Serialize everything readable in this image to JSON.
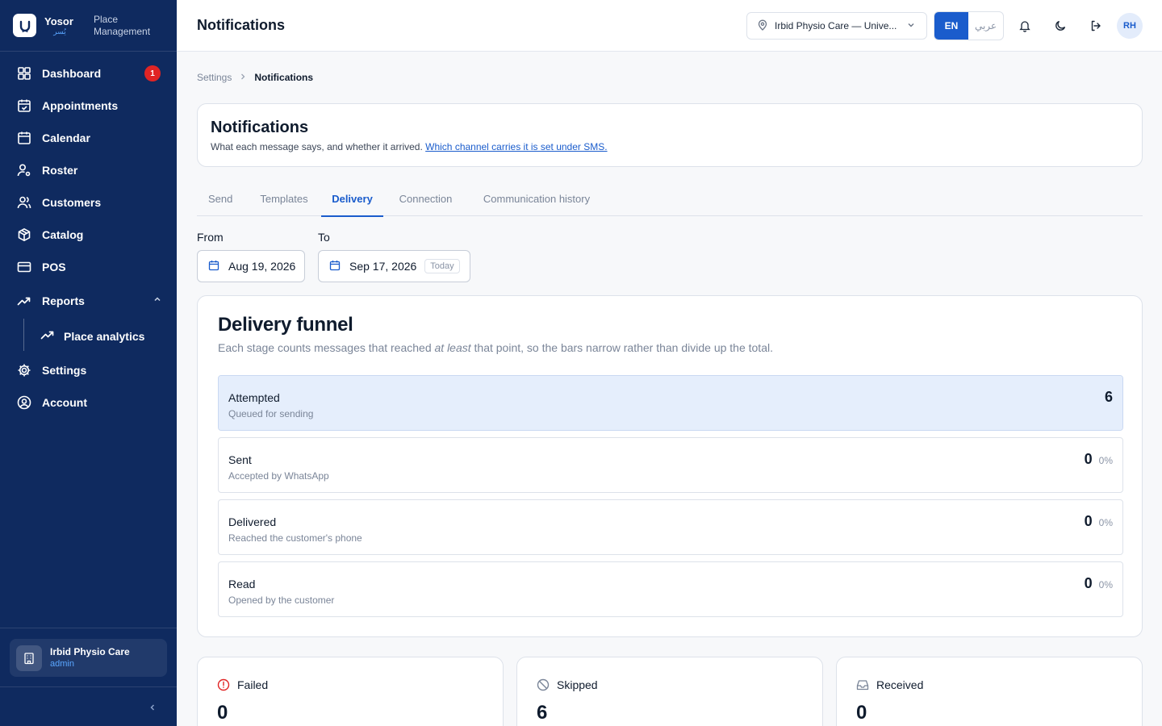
{
  "brand": {
    "name": "Yosor",
    "name_ar": "يُسر",
    "subtitle": "Place Management"
  },
  "sidebar": {
    "items": [
      {
        "label": "Dashboard",
        "icon": "dashboard-icon",
        "badge": "1"
      },
      {
        "label": "Appointments",
        "icon": "calendar-check-icon"
      },
      {
        "label": "Calendar",
        "icon": "calendar-icon"
      },
      {
        "label": "Roster",
        "icon": "user-gear-icon"
      },
      {
        "label": "Customers",
        "icon": "users-icon"
      },
      {
        "label": "Catalog",
        "icon": "box-icon"
      },
      {
        "label": "POS",
        "icon": "credit-card-icon"
      },
      {
        "label": "Reports",
        "icon": "trending-up-icon"
      }
    ],
    "sub_items": [
      {
        "label": "Place analytics",
        "icon": "trending-up-icon"
      }
    ],
    "bottom_items": [
      {
        "label": "Settings",
        "icon": "gear-icon"
      },
      {
        "label": "Account",
        "icon": "user-circle-icon"
      }
    ],
    "place": {
      "name": "Irbid Physio Care",
      "role": "admin"
    }
  },
  "header": {
    "title": "Notifications",
    "place_select": "Irbid Physio Care — Unive...",
    "lang_en": "EN",
    "lang_ar": "عربي",
    "avatar": "RH"
  },
  "breadcrumb": {
    "parent": "Settings",
    "current": "Notifications"
  },
  "page": {
    "title": "Notifications",
    "desc": "What each message says, and whether it arrived.",
    "link": "Which channel carries it is set under SMS."
  },
  "tabs": [
    "Send",
    "Templates",
    "Delivery",
    "Connection",
    "Communication history"
  ],
  "active_tab": "Delivery",
  "filters": {
    "from_label": "From",
    "from_value": "Aug 19, 2026",
    "to_label": "To",
    "to_value": "Sep 17, 2026",
    "today_chip": "Today"
  },
  "funnel": {
    "title": "Delivery funnel",
    "desc_pre": "Each stage counts messages that reached",
    "desc_em": "at least",
    "desc_post": "that point, so the bars narrow rather than divide up the total.",
    "stages": [
      {
        "name": "Attempted",
        "sub": "Queued for sending",
        "count": "6",
        "pct": "",
        "fill": 1.0
      },
      {
        "name": "Sent",
        "sub": "Accepted by WhatsApp",
        "count": "0",
        "pct": "0%",
        "fill": 0
      },
      {
        "name": "Delivered",
        "sub": "Reached the customer's phone",
        "count": "0",
        "pct": "0%",
        "fill": 0
      },
      {
        "name": "Read",
        "sub": "Opened by the customer",
        "count": "0",
        "pct": "0%",
        "fill": 0
      }
    ]
  },
  "stats": [
    {
      "label": "Failed",
      "value": "0",
      "icon": "alert-circle-icon",
      "color": "#e02424"
    },
    {
      "label": "Skipped",
      "value": "6",
      "icon": "ban-icon",
      "color": "#7a8598"
    },
    {
      "label": "Received",
      "value": "0",
      "icon": "inbox-icon",
      "color": "#7a8598"
    }
  ],
  "colors": {
    "sidebar": "#0f2a5f",
    "accent": "#1a5ccc",
    "danger": "#e02424"
  }
}
